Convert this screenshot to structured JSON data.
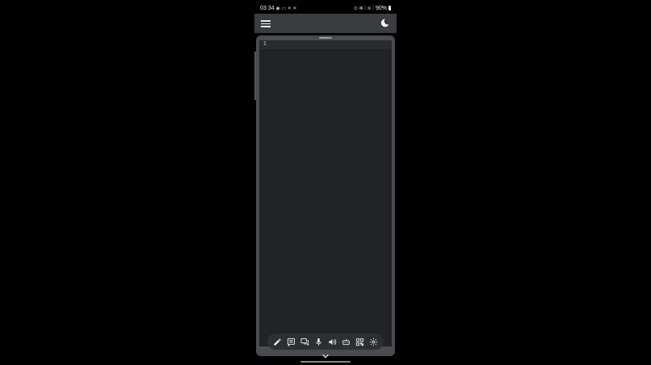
{
  "status_bar": {
    "time": "03:34",
    "left_icons": "◉ ▭ ✕ ✕",
    "right_icons": "⊙ ✻ ⁞ ≋ ⁞",
    "battery": "90%"
  },
  "icons": {
    "menu": "hamburger-menu",
    "theme": "moon",
    "tools": [
      "pencil",
      "text-box",
      "chat",
      "microphone",
      "speaker",
      "robot",
      "qr-code",
      "gear"
    ],
    "collapse": "chevron-down"
  },
  "editor": {
    "line_number": "1"
  }
}
